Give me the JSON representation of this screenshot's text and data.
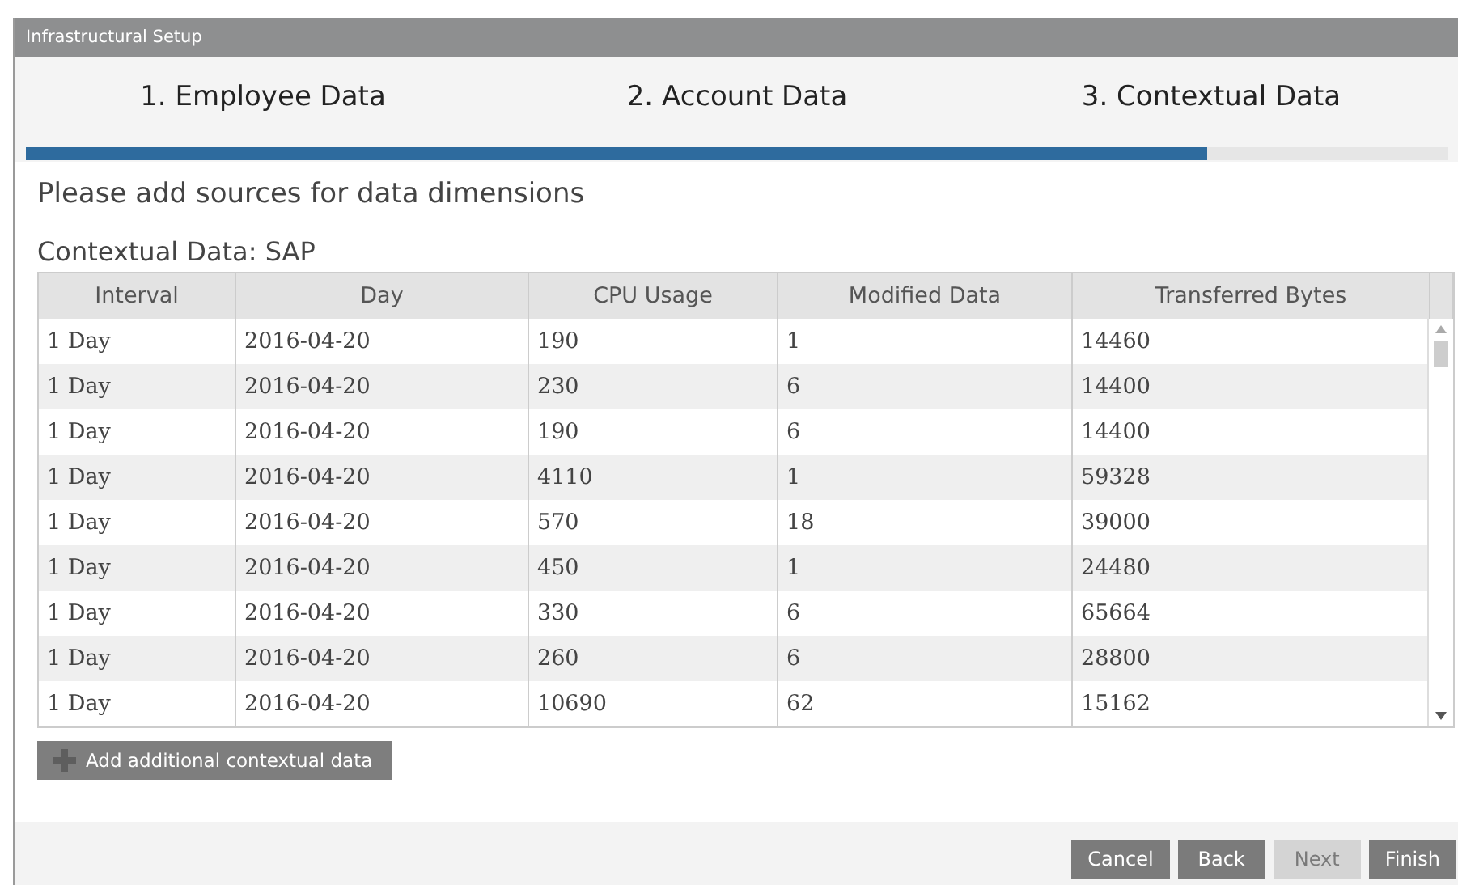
{
  "window": {
    "title": "Infrastructural Setup"
  },
  "steps": [
    {
      "label": "1. Employee Data"
    },
    {
      "label": "2. Account Data"
    },
    {
      "label": "3. Contextual Data"
    }
  ],
  "progress": {
    "level": 0.83
  },
  "heading": "Please add sources for data dimensions",
  "subheading": "Contextual Data: SAP",
  "table": {
    "columns": [
      "Interval",
      "Day",
      "CPU Usage",
      "Modified Data",
      "Transferred Bytes"
    ],
    "rows": [
      [
        "1 Day",
        "2016-04-20",
        "190",
        "1",
        "14460"
      ],
      [
        "1 Day",
        "2016-04-20",
        "230",
        "6",
        "14400"
      ],
      [
        "1 Day",
        "2016-04-20",
        "190",
        "6",
        "14400"
      ],
      [
        "1 Day",
        "2016-04-20",
        "4110",
        "1",
        "59328"
      ],
      [
        "1 Day",
        "2016-04-20",
        "570",
        "18",
        "39000"
      ],
      [
        "1 Day",
        "2016-04-20",
        "450",
        "1",
        "24480"
      ],
      [
        "1 Day",
        "2016-04-20",
        "330",
        "6",
        "65664"
      ],
      [
        "1 Day",
        "2016-04-20",
        "260",
        "6",
        "28800"
      ],
      [
        "1 Day",
        "2016-04-20",
        "10690",
        "62",
        "15162"
      ]
    ]
  },
  "add_button": "Add additional contextual data",
  "buttons": [
    {
      "label": "Cancel",
      "disabled": false
    },
    {
      "label": "Back",
      "disabled": false
    },
    {
      "label": "Next",
      "disabled": true
    },
    {
      "label": "Finish",
      "disabled": false
    }
  ]
}
